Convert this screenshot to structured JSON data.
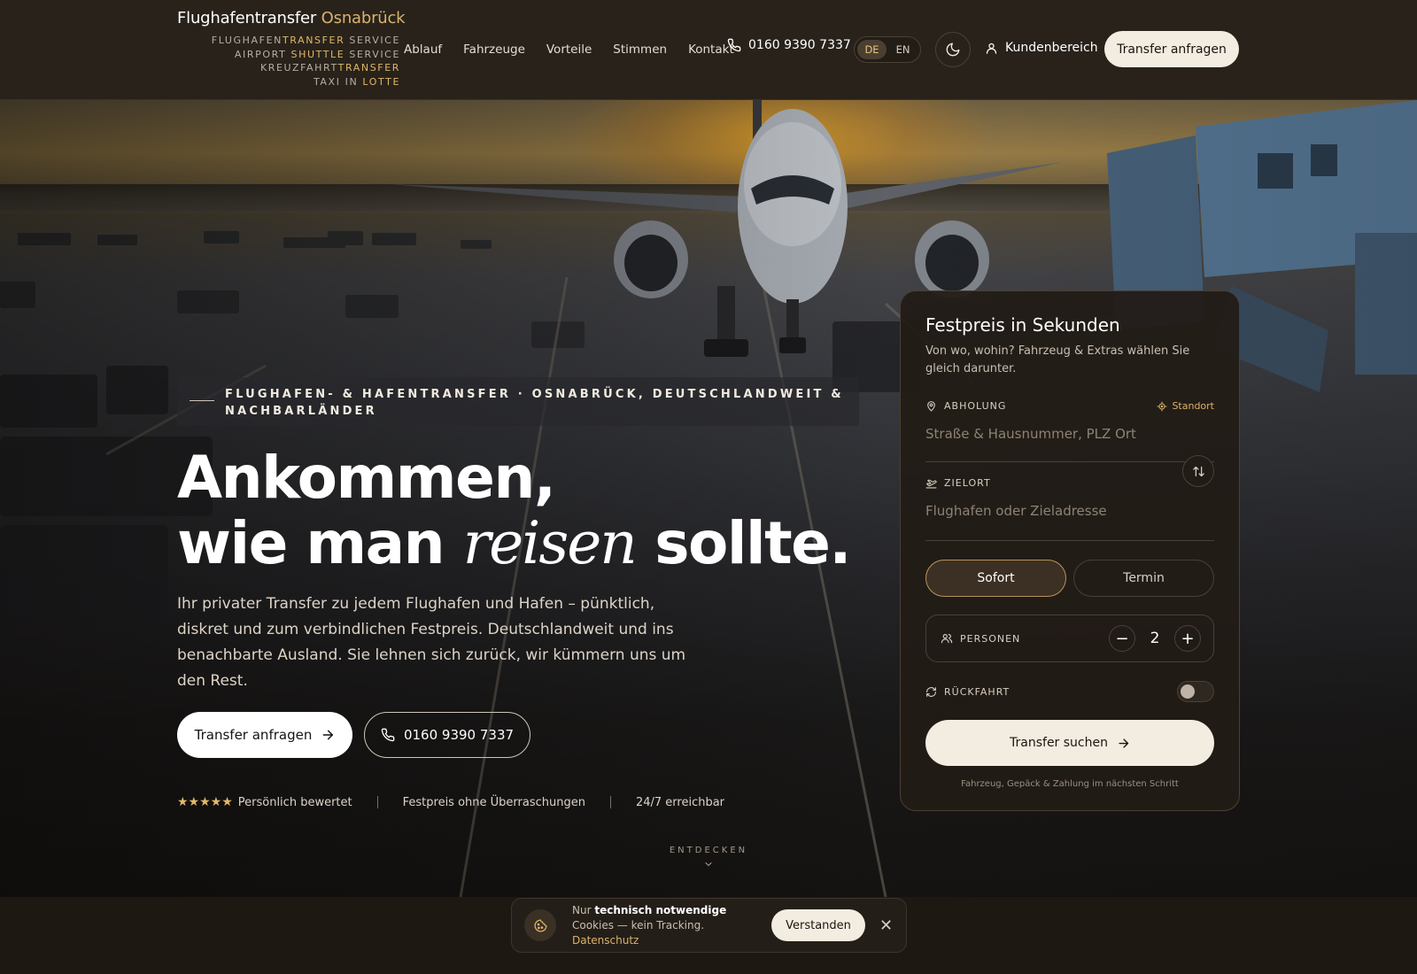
{
  "brand": {
    "name_main": "Flughafentransfer",
    "name_accent": "Osnabrück",
    "taglines": [
      {
        "pre": "FLUGHAFEN",
        "hl": "TRANSFER",
        "post": " SERVICE"
      },
      {
        "pre": "AIRPORT ",
        "hl": "SHUTTLE",
        "post": " SERVICE"
      },
      {
        "pre": "KREUZFAHRT",
        "hl": "TRANSFER",
        "post": ""
      },
      {
        "pre": "TAXI IN ",
        "hl": "LOTTE",
        "post": ""
      }
    ]
  },
  "nav": {
    "items": [
      "Ablauf",
      "Fahrzeuge",
      "Vorteile",
      "Stimmen",
      "Kontakt"
    ],
    "phone": "0160 9390 7337",
    "lang_de": "DE",
    "lang_en": "EN",
    "account": "Kundenbereich",
    "cta": "Transfer anfragen"
  },
  "hero": {
    "eyebrow": "FLUGHAFEN- & HAFENTRANSFER · OSNABRÜCK, DEUTSCHLANDWEIT & NACHBARLÄNDER",
    "headline_1": "Ankommen,",
    "headline_2a": "wie man ",
    "headline_2b": "reisen",
    "headline_2c": " sollte.",
    "lead": "Ihr privater Transfer zu jedem Flughafen und Hafen – pünktlich, diskret und zum verbindlichen Festpreis. Deutschlandweit und ins benachbarte Ausland. Sie lehnen sich zurück, wir kümmern uns um den Rest.",
    "btn_primary": "Transfer anfragen",
    "btn_phone": "0160 9390 7337",
    "stars": "★★★★★",
    "trust": [
      "Persönlich bewertet",
      "Festpreis ohne Überraschungen",
      "24/7 erreichbar"
    ],
    "discover": "ENTDECKEN"
  },
  "booking": {
    "title": "Festpreis in Sekunden",
    "subtitle": "Von wo, wohin? Fahrzeug & Extras wählen Sie gleich darunter.",
    "pickup_label": "ABHOLUNG",
    "locate_label": "Standort",
    "pickup_placeholder": "Straße & Hausnummer, PLZ Ort",
    "dest_label": "ZIELORT",
    "dest_placeholder": "Flughafen oder Zieladresse",
    "mode_now": "Sofort",
    "mode_schedule": "Termin",
    "persons_label": "PERSONEN",
    "persons_value": "2",
    "minus": "−",
    "plus": "+",
    "return_label": "RÜCKFAHRT",
    "return_on": false,
    "search_btn": "Transfer suchen",
    "note": "Fahrzeug, Gepäck & Zahlung im nächsten Schritt"
  },
  "cookie": {
    "pre": "Nur ",
    "bold": "technisch notwendige",
    "mid": " Cookies — kein Tracking. ",
    "link": "Datenschutz",
    "ok": "Verstanden",
    "close": "✕"
  },
  "colors": {
    "accent": "#d9b36a",
    "cream": "#f3ece0",
    "background": "#1d1812"
  },
  "icons": [
    "phone-icon",
    "moon-icon",
    "user-icon",
    "arrow-right-icon",
    "map-pin-icon",
    "crosshair-icon",
    "plane-icon",
    "swap-icon",
    "users-icon",
    "refresh-icon",
    "chevron-down-icon",
    "cookie-icon",
    "close-icon"
  ]
}
